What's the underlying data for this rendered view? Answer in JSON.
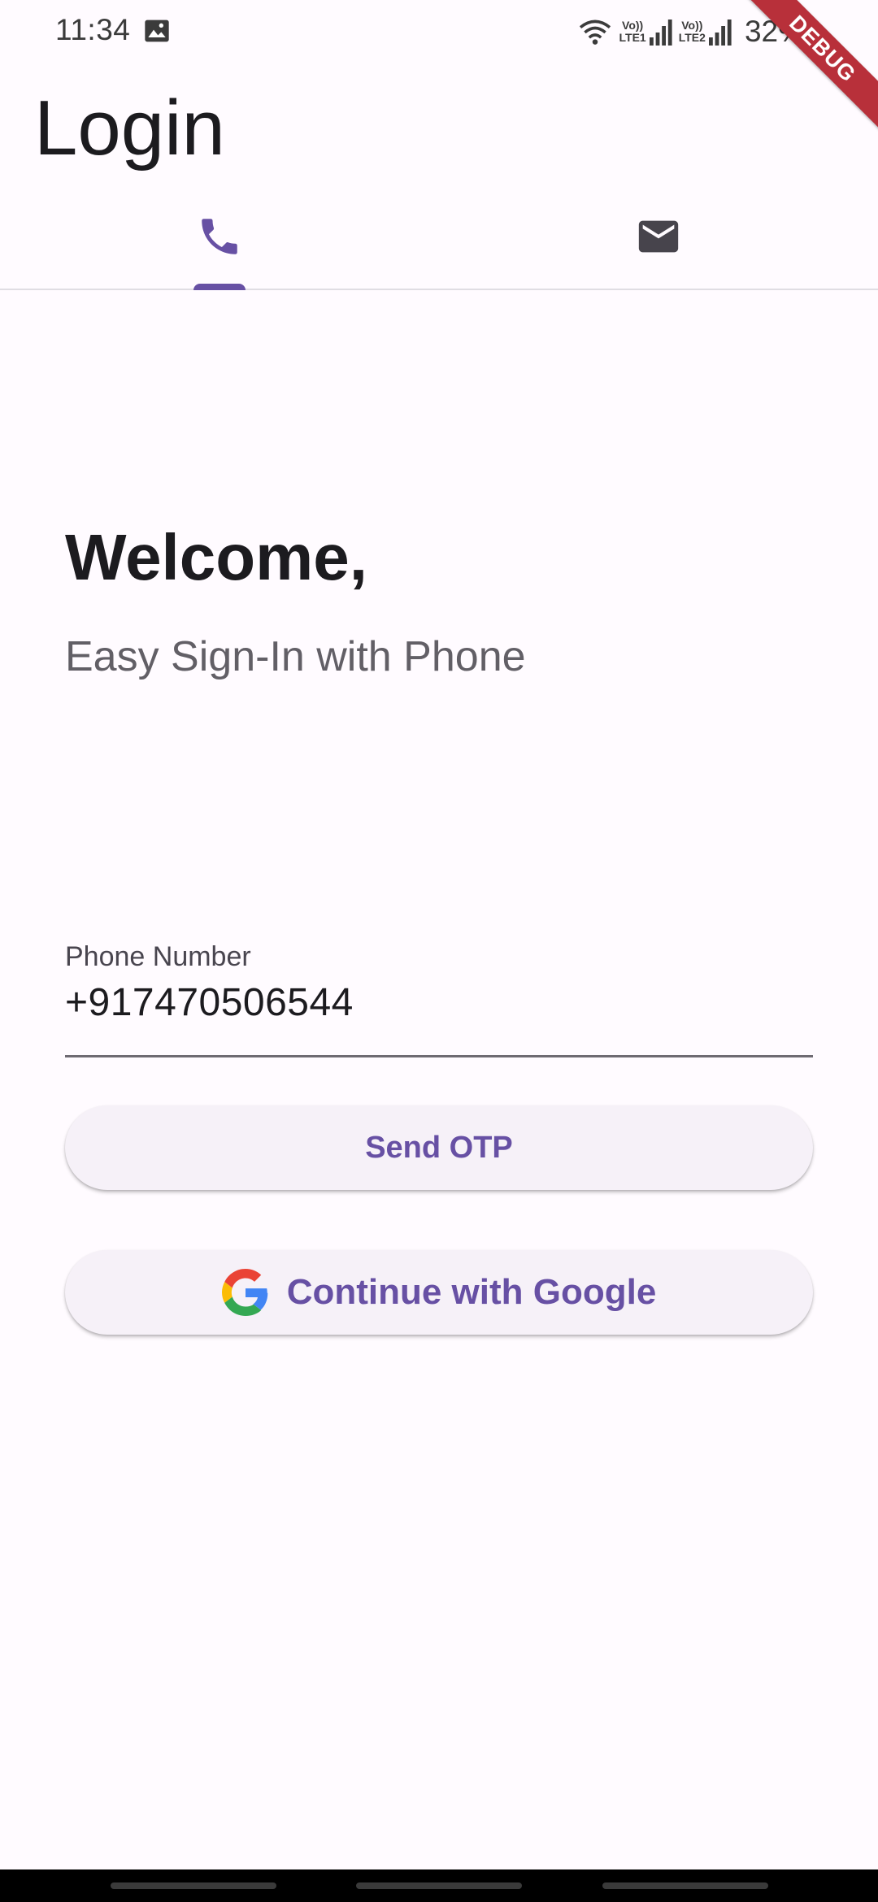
{
  "status_bar": {
    "time": "11:34",
    "battery": "32%",
    "sim1_label_top": "Vo))",
    "sim1_label_bottom": "LTE1",
    "sim2_label_top": "Vo))",
    "sim2_label_bottom": "LTE2",
    "icons": [
      "gallery-icon",
      "wifi-icon",
      "signal-icon",
      "signal-icon",
      "battery-icon"
    ]
  },
  "debug_banner": "DEBUG",
  "header": {
    "title": "Login"
  },
  "tabs": [
    {
      "icon": "phone-icon",
      "selected": true
    },
    {
      "icon": "mail-icon",
      "selected": false
    }
  ],
  "main": {
    "heading": "Welcome,",
    "subheading": "Easy Sign-In with Phone",
    "phone_field": {
      "label": "Phone Number",
      "value": "+917470506544"
    },
    "send_otp_label": "Send OTP",
    "google_label": "Continue with Google"
  },
  "colors": {
    "accent": "#6750a4",
    "background": "#fffbff",
    "debug_ribbon": "#b8303a"
  }
}
